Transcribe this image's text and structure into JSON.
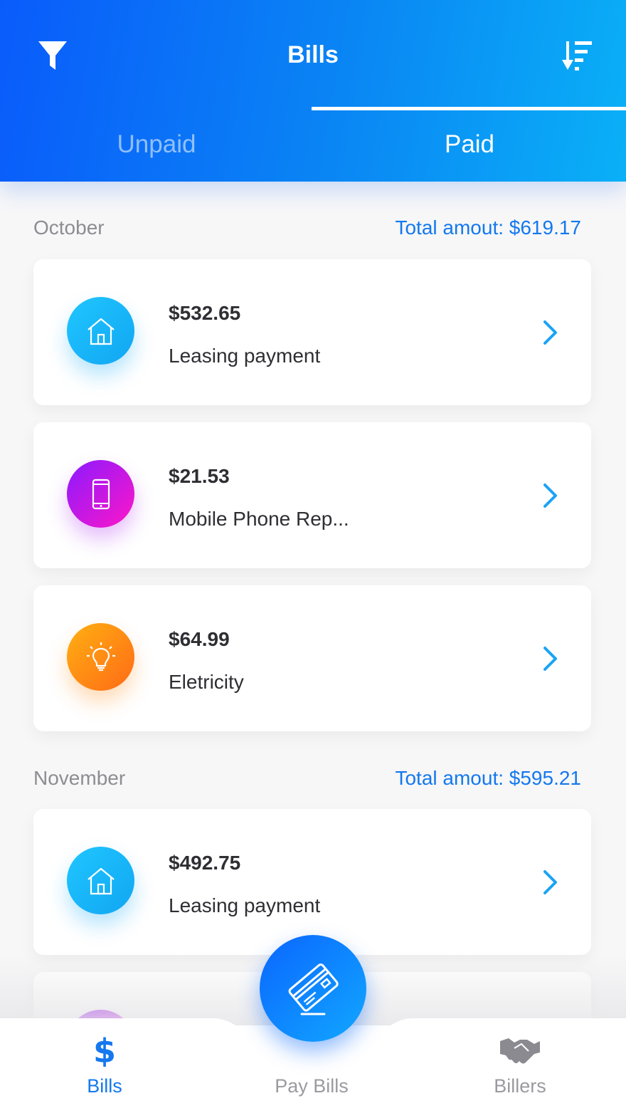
{
  "header": {
    "title": "Bills",
    "filter_icon": "filter-icon",
    "sort_icon": "sort-icon"
  },
  "tabs": [
    {
      "label": "Unpaid",
      "active": false
    },
    {
      "label": "Paid",
      "active": true
    }
  ],
  "sections": [
    {
      "month": "October",
      "total": "Total amout: $619.17",
      "bills": [
        {
          "amount": "$532.65",
          "name": "Leasing payment",
          "icon": "house-icon",
          "color": "blue"
        },
        {
          "amount": "$21.53",
          "name": "Mobile Phone Rep...",
          "icon": "phone-icon",
          "color": "purple"
        },
        {
          "amount": "$64.99",
          "name": "Eletricity",
          "icon": "lightbulb-icon",
          "color": "orange"
        }
      ]
    },
    {
      "month": "November",
      "total": "Total amout: $595.21",
      "bills": [
        {
          "amount": "$492.75",
          "name": "Leasing payment",
          "icon": "house-icon",
          "color": "blue"
        }
      ]
    }
  ],
  "bottom_nav": {
    "bills_label": "Bills",
    "pay_bills_label": "Pay Bills",
    "billers_label": "Billers"
  },
  "colors": {
    "accent": "#1478ee",
    "header_start": "#0a5bfb",
    "header_end": "#0ab0f7"
  }
}
